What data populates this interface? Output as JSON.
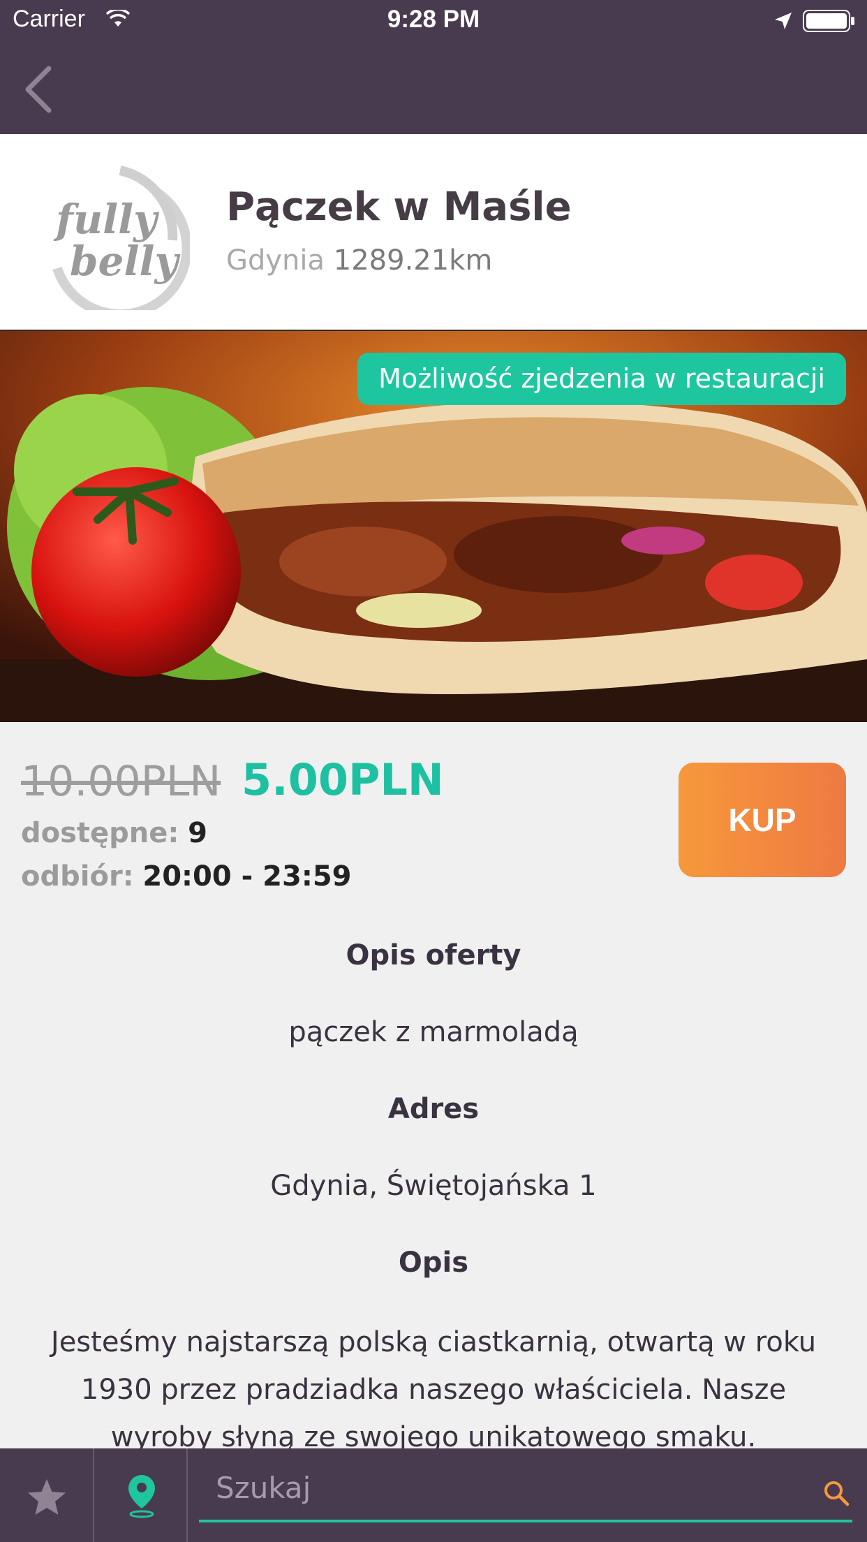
{
  "status_bar": {
    "carrier": "Carrier",
    "time": "9:28 PM"
  },
  "header": {
    "title": "Pączek w Maśle",
    "city": "Gdynia",
    "distance": "1289.21km"
  },
  "hero": {
    "badge": "Możliwość zjedzenia w restauracji"
  },
  "offer": {
    "old_price": "10.00PLN",
    "new_price": "5.00PLN",
    "available_label": "dostępne:",
    "available_value": "9",
    "pickup_label": "odbiór:",
    "pickup_value": "20:00 - 23:59",
    "buy_label": "KUP"
  },
  "details": {
    "offer_desc_heading": "Opis oferty",
    "offer_desc": "pączek z marmoladą",
    "address_heading": "Adres",
    "address": "Gdynia, Świętojańska 1",
    "desc_heading": "Opis",
    "desc": "Jesteśmy najstarszą polską ciastkarnią, otwartą w roku 1930 przez pradziadka naszego właściciela. Nasze wyroby słyną ze swojego unikatowego smaku. Zapraszamy do"
  },
  "bottom_bar": {
    "search_placeholder": "Szukaj"
  },
  "colors": {
    "primary": "#493b4f",
    "accent": "#1ec69f",
    "buy": "#f7983b"
  }
}
